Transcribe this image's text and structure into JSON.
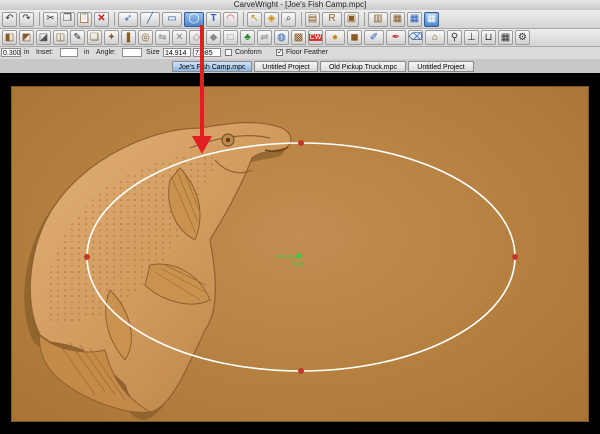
{
  "window": {
    "title": "CarveWright - [Joe's Fish Camp.mpc]"
  },
  "toolbar_icons_row1": [
    "undo-icon",
    "redo-icon",
    "cut-icon",
    "copy-icon",
    "paste-icon",
    "delete-icon",
    "select-arrow-icon",
    "line-tool-icon",
    "rectangle-tool-icon",
    "ellipse-tool-icon",
    "text-tool-icon",
    "arc-tool-icon",
    "pointer-edit-icon",
    "node-edit-icon",
    "search-icon",
    "board-icon",
    "rotate-icon",
    "window-icon",
    "pattern-icon",
    "view-icon",
    "grid-view-icon",
    "3d-view-icon"
  ],
  "toolbar_icons_row2": [
    "carve-icon",
    "pattern-icon",
    "bit-icon",
    "cube-icon",
    "pencil-icon",
    "sticker-icon",
    "cutout-icon",
    "letter-icon",
    "surface-icon",
    "mirror-icon",
    "array-icon",
    "shape-icon",
    "fill-icon",
    "outline-icon",
    "tree-icon",
    "mirror-icon",
    "globe-icon",
    "texture-icon",
    "cw-badge-icon",
    "dot-icon",
    "color-icon",
    "paint-icon",
    "pen-icon",
    "eraser-icon",
    "measure-icon",
    "hat-icon",
    "pin-icon",
    "magnet-icon",
    "grid-icon",
    "settings-icon"
  ],
  "options": {
    "depth_value": "0.300",
    "depth_unit": "in",
    "inset_label": "Inset:",
    "inset_unit": "in",
    "angle_label": "Angle:",
    "size_label": "Size",
    "width_value": "14.914",
    "height_value": "7.985",
    "conform_label": "Conform",
    "conform_checked": "",
    "floor_feather_label": "Floor Feather",
    "floor_feather_checked": "✓"
  },
  "tabs": [
    {
      "label": "Joe's Fish Camp.mpc",
      "active": true
    },
    {
      "label": "Untitled Project",
      "active": false
    },
    {
      "label": "Old Pickup Truck.mpc",
      "active": false
    },
    {
      "label": "Untitled Project",
      "active": false
    }
  ],
  "canvas": {
    "center_readout_1": "x.xxx  y.yyy",
    "center_readout_2": "0.000"
  },
  "colors": {
    "board": "#b5803f",
    "selection": "#ffffff",
    "handle": "#c0392b",
    "arrow": "#e02020",
    "readout": "#2ecc40"
  }
}
